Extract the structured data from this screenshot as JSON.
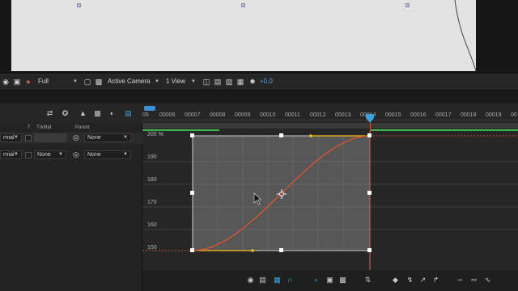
{
  "viewer": {
    "resolution": "Full",
    "camera": "Active Camera",
    "views": "1 View",
    "exposure": "+0,0"
  },
  "layer_panel": {
    "columns": {
      "t": "T",
      "trkmat": "TrkMat",
      "parent": "Parent"
    },
    "rows": [
      {
        "mode": "rmal",
        "trkmat": "",
        "parent": "None"
      },
      {
        "mode": "rmal",
        "trkmat": "None",
        "parent": "None"
      }
    ]
  },
  "timeline": {
    "ticks": [
      "05",
      "00006",
      "00007",
      "00008",
      "00009",
      "00010",
      "00011",
      "00012",
      "00013",
      "00014",
      "00015",
      "00016",
      "00017",
      "00018",
      "00019",
      "00"
    ],
    "graph": {
      "y_labels": [
        "200 %",
        "190",
        "180",
        "170",
        "160",
        "150"
      ]
    }
  },
  "colors": {
    "curve": "#e0532f",
    "handle": "#f2c21b",
    "playhead": "#3da0e0",
    "work_area": "#39b54a"
  }
}
